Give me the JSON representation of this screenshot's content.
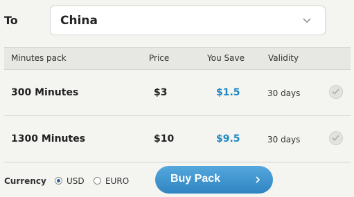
{
  "destination": {
    "label": "To",
    "value": "China",
    "icon": "chevron-down-icon"
  },
  "table": {
    "headers": [
      "Minutes pack",
      "Price",
      "You Save",
      "Validity"
    ],
    "rows": [
      {
        "minutes": "300 Minutes",
        "price": "$3",
        "save": "$1.5",
        "validity": "30 days",
        "selected": false
      },
      {
        "minutes": "1300 Minutes",
        "price": "$10",
        "save": "$9.5",
        "validity": "30 days",
        "selected": false
      }
    ]
  },
  "footer": {
    "currency_label": "Currency",
    "options": [
      {
        "label": "USD",
        "selected": true
      },
      {
        "label": "EURO",
        "selected": false
      }
    ],
    "buy_label": "Buy Pack"
  },
  "colors": {
    "accent": "#1e88c4",
    "button": "#3b91cf"
  }
}
